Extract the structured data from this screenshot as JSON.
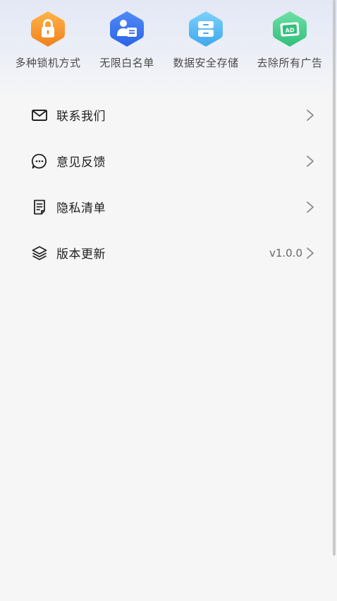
{
  "features": [
    {
      "label": "多种锁机方式",
      "icon": "lock-icon",
      "color_top": "#ffb447",
      "color_bottom": "#f0801d"
    },
    {
      "label": "无限白名单",
      "icon": "contact-card-icon",
      "color_top": "#4f8af7",
      "color_bottom": "#2c64e6"
    },
    {
      "label": "数据安全存储",
      "icon": "storage-cabinet-icon",
      "color_top": "#7dd0fb",
      "color_bottom": "#3fa8ee"
    },
    {
      "label": "去除所有广告",
      "icon": "ad-block-icon",
      "color_top": "#6fe0a5",
      "color_bottom": "#30bf7c"
    }
  ],
  "menu": [
    {
      "label": "联系我们",
      "icon": "mail-icon",
      "value": ""
    },
    {
      "label": "意见反馈",
      "icon": "chat-bubble-icon",
      "value": ""
    },
    {
      "label": "隐私清单",
      "icon": "document-icon",
      "value": ""
    },
    {
      "label": "版本更新",
      "icon": "layers-icon",
      "value": "v1.0.0"
    }
  ]
}
